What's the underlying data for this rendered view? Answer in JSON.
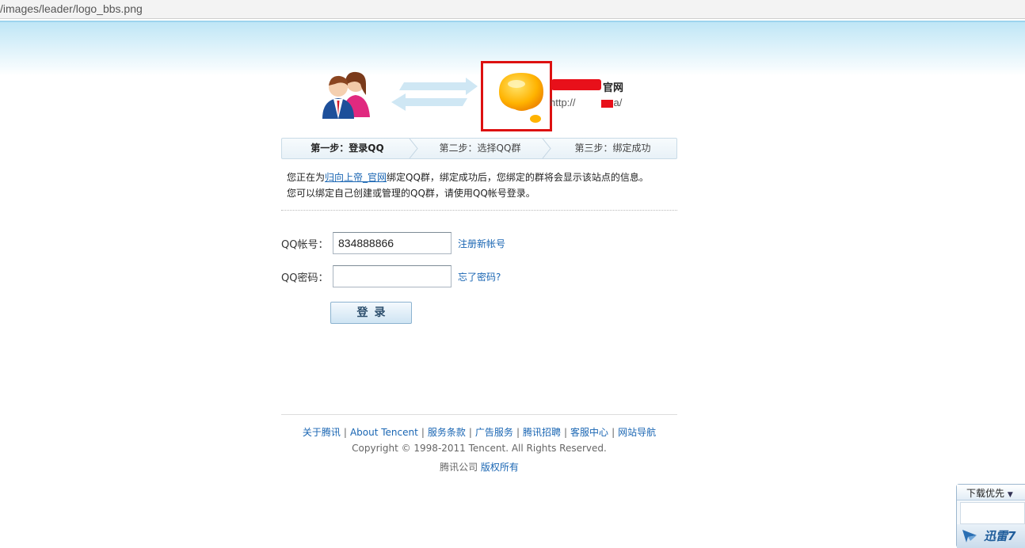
{
  "browser": {
    "url_text": "/images/leader/logo_bbs.png"
  },
  "header": {
    "site_name_suffix": "官网",
    "site_url_prefix": "http://",
    "site_url_suffix": "a/"
  },
  "steps": [
    {
      "label": "第一步：登录QQ",
      "active": true
    },
    {
      "label": "第二步：选择QQ群",
      "active": false
    },
    {
      "label": "第三步：绑定成功",
      "active": false
    }
  ],
  "intro": {
    "line1_prefix": "您正在为",
    "line1_link": "归向上帝_官网",
    "line1_suffix": "绑定QQ群，绑定成功后，您绑定的群将会显示该站点的信息。",
    "line2": "您可以绑定自己创建或管理的QQ群，请使用QQ帐号登录。"
  },
  "form": {
    "account_label": "QQ帐号：",
    "account_value": "834888866",
    "register_link": "注册新帐号",
    "password_label": "QQ密码：",
    "password_value": "",
    "forgot_link": "忘了密码?",
    "login_button": "登录"
  },
  "footer": {
    "links": [
      "关于腾讯",
      "About Tencent",
      "服务条款",
      "广告服务",
      "腾讯招聘",
      "客服中心",
      "网站导航"
    ],
    "separator": "|",
    "copyright": "Copyright © 1998-2011 Tencent. All Rights Reserved.",
    "corp_prefix": "腾讯公司",
    "corp_link": "版权所有"
  },
  "download_widget": {
    "header": "下载优先",
    "brand": "迅雷7"
  },
  "colors": {
    "link": "#1a66b3",
    "highlight_border": "#dd1111",
    "redaction": "#e8101a",
    "bubble": "#ffb300"
  }
}
